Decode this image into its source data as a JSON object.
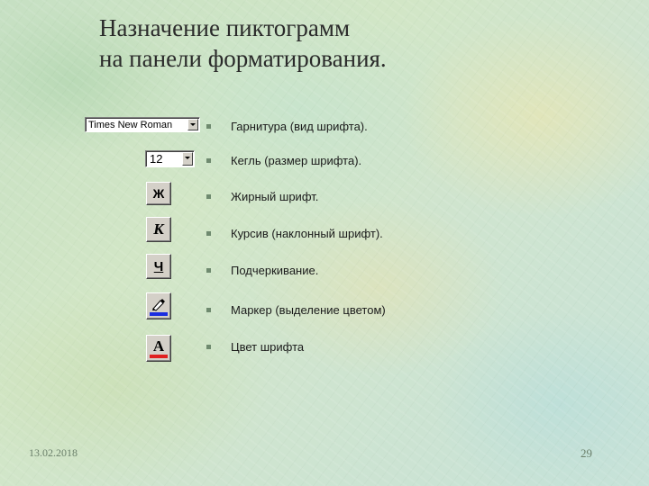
{
  "slide": {
    "title_line1": "Назначение пиктограмм",
    "title_line2": "на панели форматирования.",
    "date": "13.02.2018",
    "page_number": "29"
  },
  "controls": {
    "font_name_value": "Times New Roman",
    "font_size_value": "12",
    "bold_glyph": "Ж",
    "italic_glyph": "К",
    "underline_glyph": "Ч",
    "font_color_glyph": "A"
  },
  "items": [
    {
      "label": "Гарнитура (вид шрифта)."
    },
    {
      "label": "Кегль  (размер шрифта)."
    },
    {
      "label": "Жирный шрифт."
    },
    {
      "label": "Курсив (наклонный шрифт)."
    },
    {
      "label": "Подчеркивание."
    },
    {
      "label": "Маркер  (выделение цветом)"
    },
    {
      "label": "Цвет шрифта"
    }
  ],
  "colors": {
    "highlight_bar": "#1a2de0",
    "font_color_bar": "#e02020",
    "toolbar_face": "#d4d0c8"
  }
}
